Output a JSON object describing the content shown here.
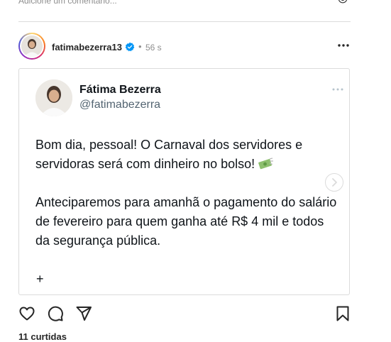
{
  "comment": {
    "placeholder": "Adicione um comentário..."
  },
  "post": {
    "username": "fatimabezerra13",
    "separator": "•",
    "time": "56 s"
  },
  "tweet": {
    "name": "Fátima Bezerra",
    "handle": "@fatimabezerra",
    "paragraph1": "Bom dia, pessoal! O Carnaval dos servidores e servidoras será com dinheiro no bolso!",
    "paragraph2": "Anteciparemos para amanhã o pagamento do salário de fevereiro para quem ganha até R$ 4 mil e todos da segurança pública.",
    "plus": "+"
  },
  "likes": "11 curtidas",
  "colors": {
    "verified": "#0095f6",
    "muted": "#8e8e8e",
    "border": "#dbdbdb"
  },
  "icons": [
    "emoji-icon",
    "verified-icon",
    "more-icon",
    "money-icon",
    "chevron-right-icon",
    "heart-icon",
    "comment-icon",
    "share-icon",
    "bookmark-icon"
  ]
}
